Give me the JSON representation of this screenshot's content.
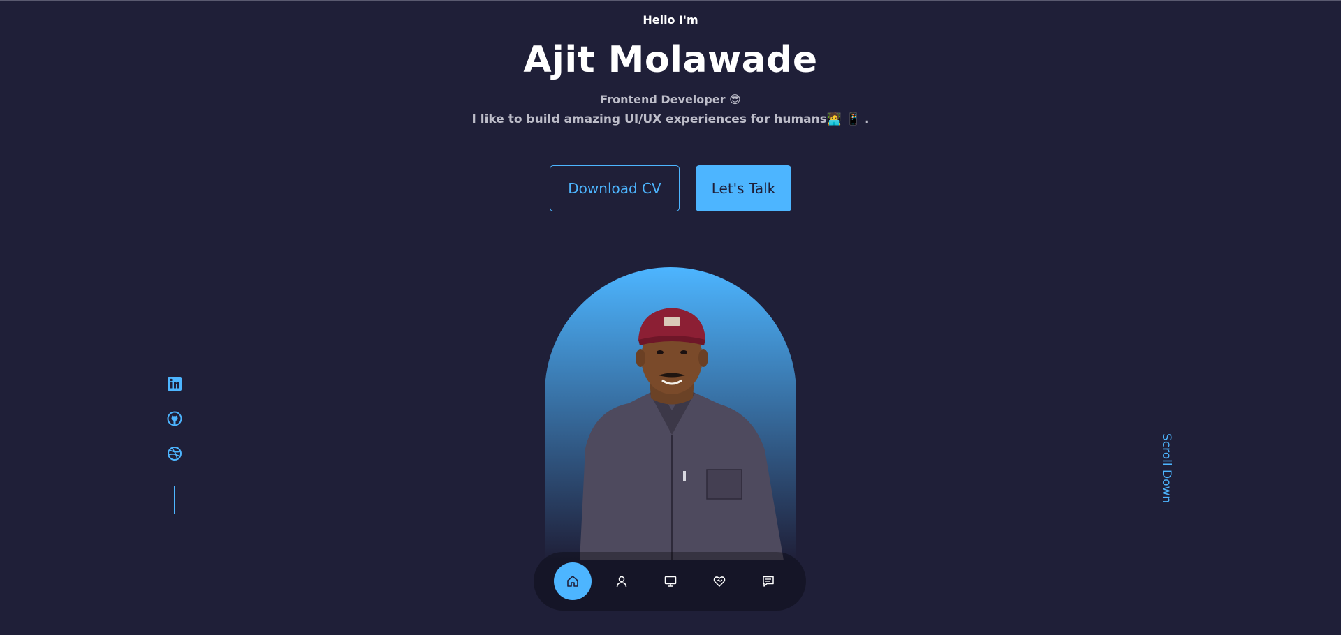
{
  "hero": {
    "greeting": "Hello I'm",
    "name": "Ajit Molawade",
    "role": "Frontend Developer 😎",
    "tagline": "I like to build amazing UI/UX experiences for humans🧑‍💻 📱 ."
  },
  "cta": {
    "download_label": "Download CV",
    "talk_label": "Let's Talk"
  },
  "socials": [
    {
      "icon": "linkedin-icon"
    },
    {
      "icon": "github-icon"
    },
    {
      "icon": "dribbble-icon"
    }
  ],
  "scroll": {
    "label": "Scroll Down"
  },
  "nav": {
    "items": [
      {
        "icon": "home-icon",
        "active": true
      },
      {
        "icon": "user-icon",
        "active": false
      },
      {
        "icon": "monitor-icon",
        "active": false
      },
      {
        "icon": "services-icon",
        "active": false
      },
      {
        "icon": "message-icon",
        "active": false
      }
    ]
  },
  "colors": {
    "background": "#1f1f38",
    "accent": "#4db5ff",
    "muted_text": "#bdbdc9"
  }
}
